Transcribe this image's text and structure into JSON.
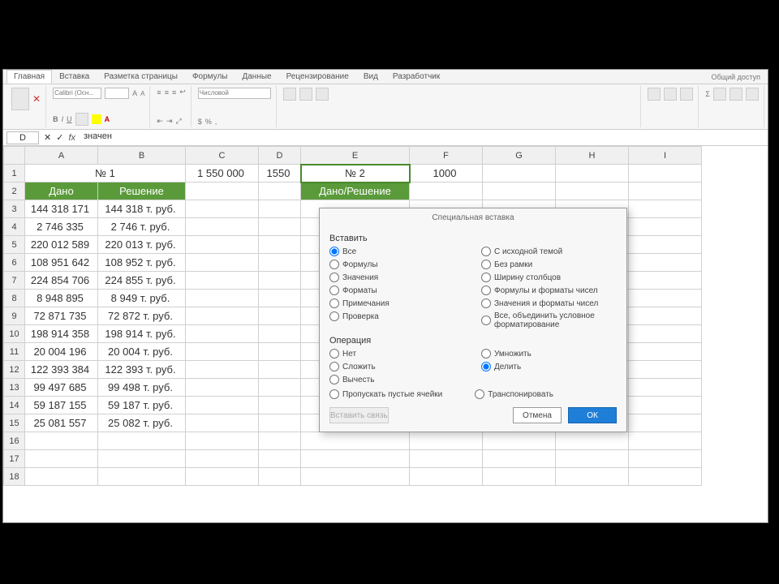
{
  "ribbon": {
    "tabs": [
      "Главная",
      "Вставка",
      "Разметка страницы",
      "Формулы",
      "Данные",
      "Рецензирование",
      "Вид",
      "Разработчик"
    ],
    "active_tab": 0,
    "quick_label": "Общий доступ",
    "font_name": "Calibri (Осн...",
    "number_format": "Числовой"
  },
  "formula_bar": {
    "name_box": "D",
    "formula": "значен"
  },
  "columns": [
    "A",
    "B",
    "C",
    "D",
    "E",
    "F",
    "G",
    "H",
    "I"
  ],
  "row_headers": [
    "1",
    "2",
    "3",
    "4",
    "5",
    "6",
    "7",
    "8",
    "9",
    "10",
    "11",
    "12",
    "13",
    "14",
    "15",
    "16",
    "17",
    "18"
  ],
  "cells": {
    "B1": "№ 1",
    "C1": "1 550 000",
    "D1": "1550",
    "E1": "№ 2",
    "F1": "1000",
    "A2": "Дано",
    "B2": "Решение",
    "E2": "Дано/Решение"
  },
  "data_rows": [
    {
      "a": "144 318 171",
      "b": "144 318 т. руб."
    },
    {
      "a": "2 746 335",
      "b": "2 746 т. руб."
    },
    {
      "a": "220 012 589",
      "b": "220 013 т. руб."
    },
    {
      "a": "108 951 642",
      "b": "108 952 т. руб."
    },
    {
      "a": "224 854 706",
      "b": "224 855 т. руб."
    },
    {
      "a": "8 948 895",
      "b": "8 949 т. руб."
    },
    {
      "a": "72 871 735",
      "b": "72 872 т. руб."
    },
    {
      "a": "198 914 358",
      "b": "198 914 т. руб."
    },
    {
      "a": "20 004 196",
      "b": "20 004 т. руб."
    },
    {
      "a": "122 393 384",
      "b": "122 393 т. руб."
    },
    {
      "a": "99 497 685",
      "b": "99 498 т. руб."
    },
    {
      "a": "59 187 155",
      "b": "59 187 т. руб."
    },
    {
      "a": "25 081 557",
      "b": "25 082 т. руб."
    }
  ],
  "dialog": {
    "title": "Специальная вставка",
    "section_insert": "Вставить",
    "insert_left": [
      "Все",
      "Формулы",
      "Значения",
      "Форматы",
      "Примечания",
      "Проверка"
    ],
    "insert_right": [
      "С исходной темой",
      "Без рамки",
      "Ширину столбцов",
      "Формулы и форматы чисел",
      "Значения и форматы чисел",
      "Все, объединить условное форматирование"
    ],
    "insert_selected_left": 0,
    "section_operation": "Операция",
    "op_left": [
      "Нет",
      "Сложить",
      "Вычесть"
    ],
    "op_right": [
      "Умножить",
      "Делить"
    ],
    "op_selected_col": "right",
    "op_selected_idx": 1,
    "skip_blanks": "Пропускать пустые ячейки",
    "transpose": "Транспонировать",
    "insert_link": "Вставить связь",
    "btn_cancel": "Отмена",
    "btn_ok": "ОК"
  }
}
